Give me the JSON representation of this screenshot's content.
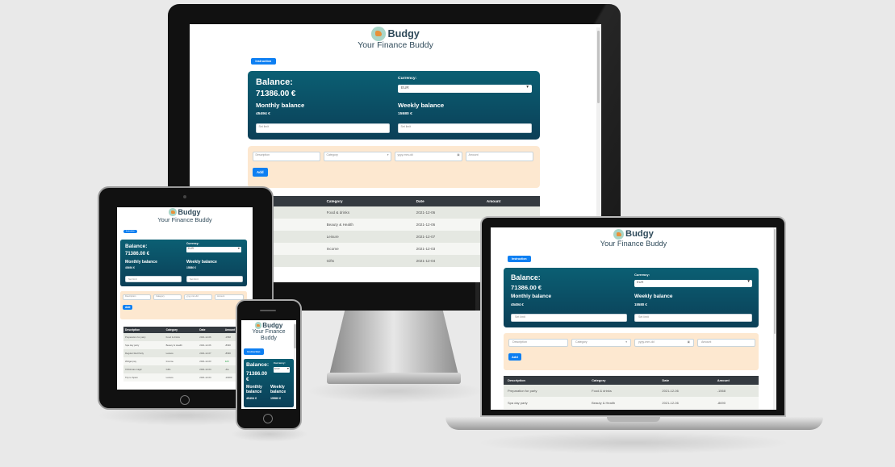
{
  "app": {
    "brand": "Budgy",
    "tagline": "Your Finance Buddy",
    "tagline_phone_line1": "Your Finance",
    "tagline_phone_line2": "Buddy",
    "instructions_label": "Instruction",
    "balance_label": "Balance:",
    "balance_value": "71386.00 €",
    "currency_label": "Currency:",
    "currency_selected": "EUR",
    "monthly_label": "Monthly balance",
    "monthly_value": "45494 €",
    "weekly_label": "Weekly balance",
    "weekly_value": "15580 €",
    "monthly_phone_l1": "Monthly",
    "weekly_phone_l1": "Weekly",
    "phone_l2": "balance",
    "set_limit_placeholder": "Set limit",
    "description_placeholder": "Description",
    "category_placeholder": "Category",
    "date_placeholder": "yyyy-mm-dd",
    "amount_placeholder": "Amount",
    "add_label": "Add",
    "columns": [
      "Description",
      "Category",
      "Date",
      "Amount"
    ],
    "rows": [
      [
        "Preparation for party",
        "Food & drinks",
        "2021-12-06",
        "-1568"
      ],
      [
        "Spa day party",
        "Beauty & Health",
        "2021-12-06",
        "-8690"
      ],
      [
        "Regular Red Party",
        "Leisure",
        "2021-12-07",
        "-8690"
      ],
      [
        "Widget pay",
        "Income",
        "2021-12-03",
        "120"
      ],
      [
        "Christmas magic",
        "Gifts",
        "2021-12-04",
        "-4ia"
      ],
      [
        "Trip to Spain",
        "Leisure",
        "2021-12-04",
        "-10000"
      ]
    ],
    "monitor_rows": [
      [
        "r for party",
        "Food & drinks",
        "2021-12-06",
        ""
      ],
      [
        "party",
        "Beauty & Health",
        "2021-12-06",
        ""
      ],
      [
        "d Party",
        "Leisure",
        "2021-12-07",
        ""
      ],
      [
        "",
        "Income",
        "2021-12-03",
        ""
      ],
      [
        "magic",
        "Gifts",
        "2021-12-04",
        ""
      ]
    ]
  },
  "colors": {
    "accent": "#0d7ff2",
    "card": "#0b4f66",
    "form_bg": "#fde8d0",
    "table_header": "#343a40"
  }
}
